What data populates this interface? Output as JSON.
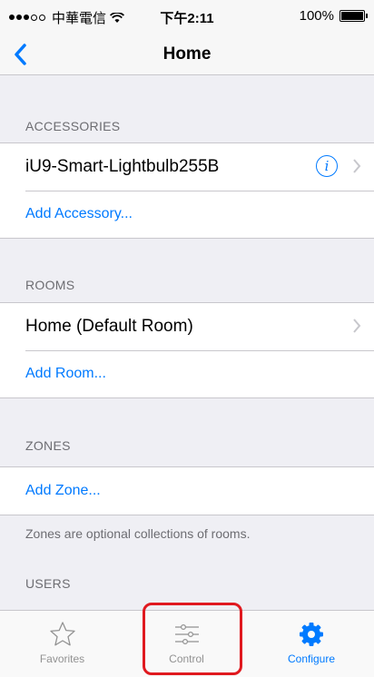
{
  "status_bar": {
    "carrier": "中華電信",
    "time": "下午2:11",
    "battery": "100%"
  },
  "nav": {
    "title": "Home"
  },
  "sections": {
    "accessories": {
      "header": "ACCESSORIES",
      "item": "iU9-Smart-Lightbulb255B",
      "add": "Add Accessory..."
    },
    "rooms": {
      "header": "ROOMS",
      "item": "Home (Default Room)",
      "add": "Add Room..."
    },
    "zones": {
      "header": "ZONES",
      "add": "Add Zone...",
      "footer": "Zones are optional collections of rooms."
    },
    "users": {
      "header": "USERS"
    }
  },
  "tabbar": {
    "favorites": "Favorites",
    "control": "Control",
    "configure": "Configure"
  },
  "colors": {
    "accent": "#007aff",
    "background": "#efeff4",
    "highlight": "#e0191f"
  }
}
